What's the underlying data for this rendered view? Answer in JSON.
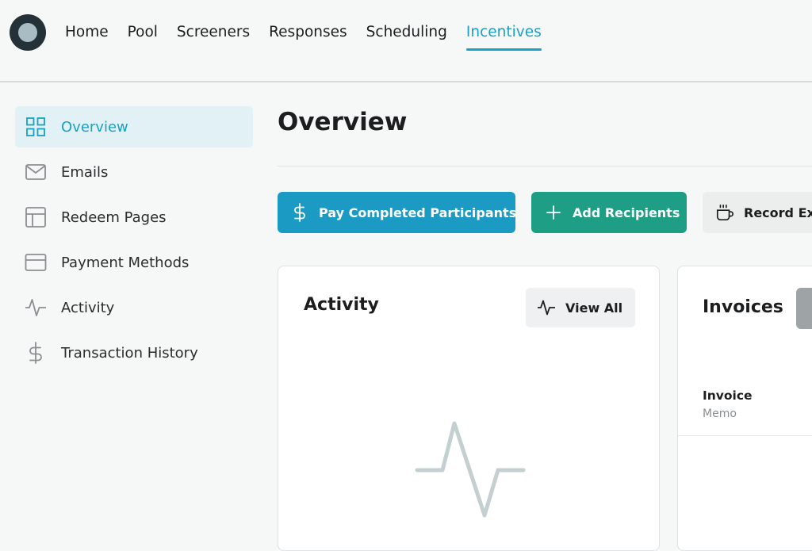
{
  "topnav": {
    "items": [
      {
        "label": "Home",
        "active": false
      },
      {
        "label": "Pool",
        "active": false
      },
      {
        "label": "Screeners",
        "active": false
      },
      {
        "label": "Responses",
        "active": false
      },
      {
        "label": "Scheduling",
        "active": false
      },
      {
        "label": "Incentives",
        "active": true
      }
    ]
  },
  "sidebar": {
    "items": [
      {
        "label": "Overview",
        "icon": "grid-icon",
        "active": true
      },
      {
        "label": "Emails",
        "icon": "mail-icon",
        "active": false
      },
      {
        "label": "Redeem Pages",
        "icon": "layout-icon",
        "active": false
      },
      {
        "label": "Payment Methods",
        "icon": "credit-card-icon",
        "active": false
      },
      {
        "label": "Activity",
        "icon": "activity-icon",
        "active": false
      },
      {
        "label": "Transaction History",
        "icon": "dollar-icon",
        "active": false
      }
    ]
  },
  "main": {
    "title": "Overview",
    "actions": {
      "pay_label": "Pay Completed Participants",
      "add_label": "Add Recipients",
      "record_label": "Record Ext"
    },
    "activity_card": {
      "title": "Activity",
      "view_all_label": "View All"
    },
    "invoices_card": {
      "title": "Invoices",
      "column_label": "Invoice",
      "column_sub": "Memo"
    }
  },
  "colors": {
    "accent": "#1aa0c4",
    "pay_button": "#1b9ac3",
    "add_button": "#1f9e86",
    "logo_dark": "#243238",
    "logo_light": "#a9bcc4"
  }
}
